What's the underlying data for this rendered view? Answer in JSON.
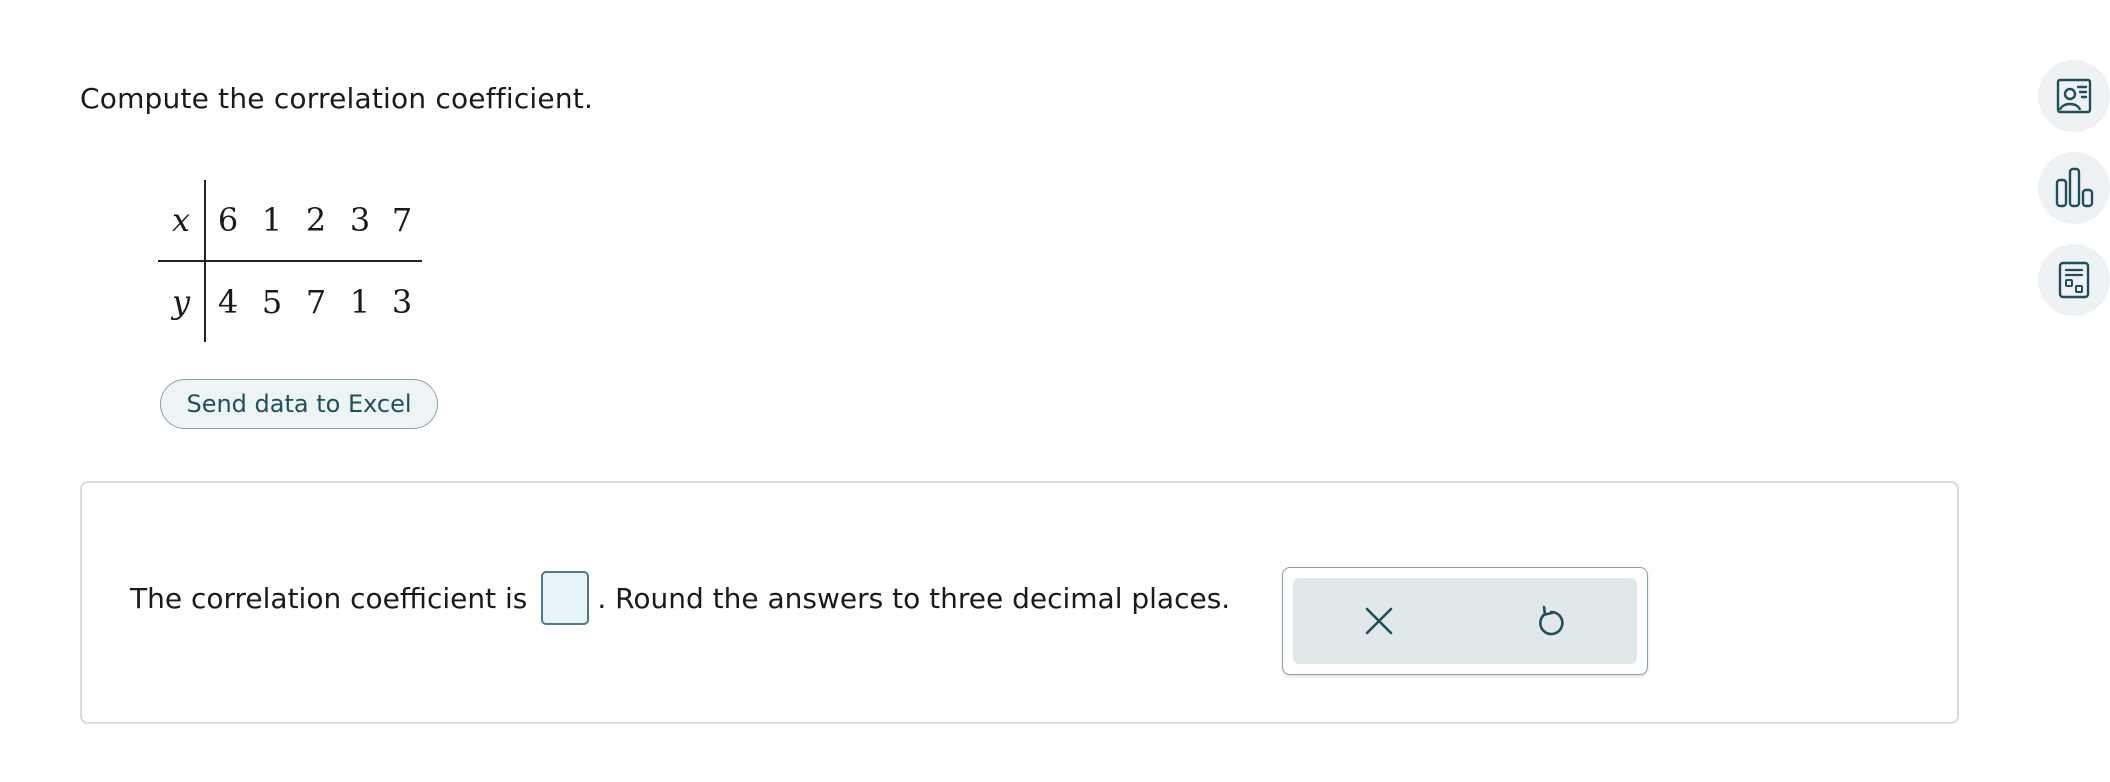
{
  "question": {
    "prompt": "Compute the correlation coefficient."
  },
  "table": {
    "x_label": "x",
    "y_label": "y",
    "x_values": [
      "6",
      "1",
      "2",
      "3",
      "7"
    ],
    "y_values": [
      "4",
      "5",
      "7",
      "1",
      "3"
    ]
  },
  "excel_button": {
    "label": "Send data to Excel"
  },
  "answer": {
    "text_before": "The correlation coefficient is",
    "input_value": "",
    "text_after": ". Round the answers to three decimal places."
  },
  "tools": {
    "clear_icon": "close-icon",
    "undo_icon": "undo-icon"
  },
  "side_tools": [
    {
      "icon": "presenter-icon"
    },
    {
      "icon": "bar-chart-icon"
    },
    {
      "icon": "calculator-icon"
    }
  ],
  "colors": {
    "accent": "#1f4f5c",
    "input_bg": "#e8f4f8",
    "palette_bg": "#e1e8ea"
  }
}
